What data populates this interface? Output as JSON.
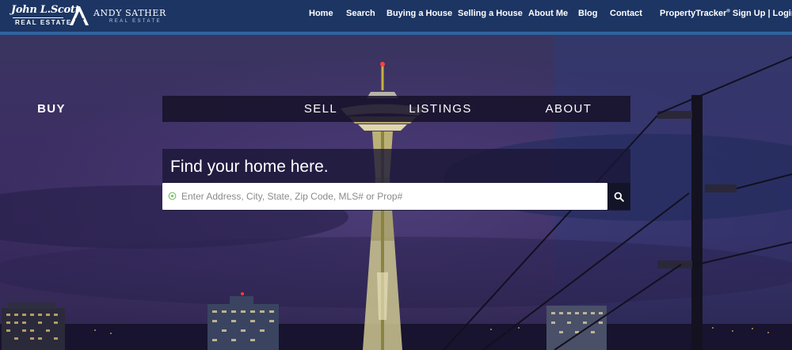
{
  "brand": {
    "primary_name": "John L.Scott",
    "primary_sub": "REAL ESTATE",
    "agent_name": "ANDY SATHER",
    "agent_sub": "REAL ESTATE"
  },
  "nav": {
    "items": [
      {
        "label": "Home"
      },
      {
        "label": "Search"
      },
      {
        "label": "Buying a House"
      },
      {
        "label": "Selling a House"
      },
      {
        "label": "About Me"
      },
      {
        "label": "Blog"
      },
      {
        "label": "Contact"
      }
    ],
    "tracker_label": "PropertyTracker",
    "tracker_mark": "®",
    "signup_label": " Sign Up",
    "divider": " | ",
    "login_label": "Login"
  },
  "hero": {
    "tabs": [
      {
        "label": "BUY",
        "active": true
      },
      {
        "label": "SELL",
        "active": false
      },
      {
        "label": "LISTINGS",
        "active": false
      },
      {
        "label": "ABOUT",
        "active": false
      }
    ],
    "heading": "Find your home here.",
    "search": {
      "value": "",
      "placeholder": "Enter Address, City, State, Zip Code, MLS# or Prop#"
    }
  },
  "icons": {
    "search_button": "search-icon",
    "input_marker": "location-pin-icon",
    "agent_logo": "letter-a-logo-icon"
  },
  "colors": {
    "topbar": "#1c3563",
    "topbar_stripe": "#2d64a0",
    "tab_bar": "#18122a",
    "search_button": "#141428",
    "accent_pin": "#7cc36a"
  }
}
